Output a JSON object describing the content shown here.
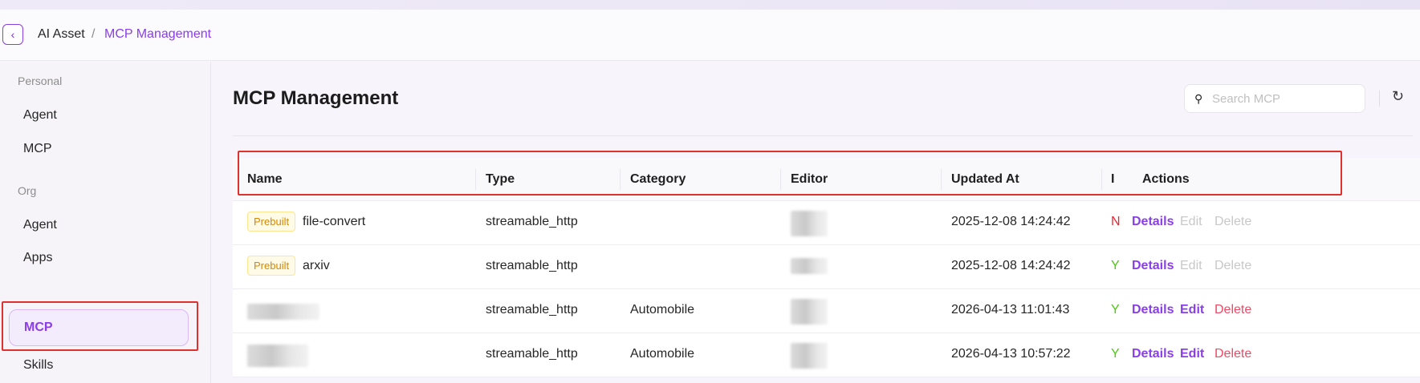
{
  "breadcrumb": {
    "back_icon": "chevron-left-icon",
    "root": "AI Asset",
    "separator": "/",
    "current": "MCP Management"
  },
  "sidebar": {
    "groups": [
      {
        "label": "Personal",
        "items": [
          "Agent",
          "MCP"
        ]
      },
      {
        "label": "Org",
        "items": [
          "Agent",
          "Apps",
          "MCP",
          "Skills"
        ]
      }
    ],
    "active": "MCP"
  },
  "main": {
    "title": "MCP Management",
    "search_placeholder": "Search MCP",
    "search_icon": "search-icon",
    "refresh_icon": "refresh-icon"
  },
  "table": {
    "columns": [
      "Name",
      "Type",
      "Category",
      "Editor",
      "Updated At",
      "I",
      "Actions"
    ],
    "rows": [
      {
        "tag": "Prebuilt",
        "name": "file-convert",
        "type": "streamable_http",
        "category": "",
        "updated": "2025-12-08 14:24:42",
        "status": "N",
        "status_color": "#f5222d",
        "editable": false
      },
      {
        "tag": "Prebuilt",
        "name": "arxiv",
        "type": "streamable_http",
        "category": "",
        "updated": "2025-12-08 14:24:42",
        "status": "Y",
        "status_color": "#52c41a",
        "editable": false
      },
      {
        "tag": "",
        "name": "",
        "type": "streamable_http",
        "category": "Automobile",
        "updated": "2026-04-13 11:01:43",
        "status": "Y",
        "status_color": "#52c41a",
        "editable": true
      },
      {
        "tag": "",
        "name": "",
        "type": "streamable_http",
        "category": "Automobile",
        "updated": "2026-04-13 10:57:22",
        "status": "Y",
        "status_color": "#52c41a",
        "editable": true
      }
    ],
    "actions": {
      "details": "Details",
      "edit": "Edit",
      "delete": "Delete"
    }
  },
  "colors": {
    "accent": "#8a3ee8",
    "highlight": "#e0312f",
    "danger": "#f04864"
  }
}
